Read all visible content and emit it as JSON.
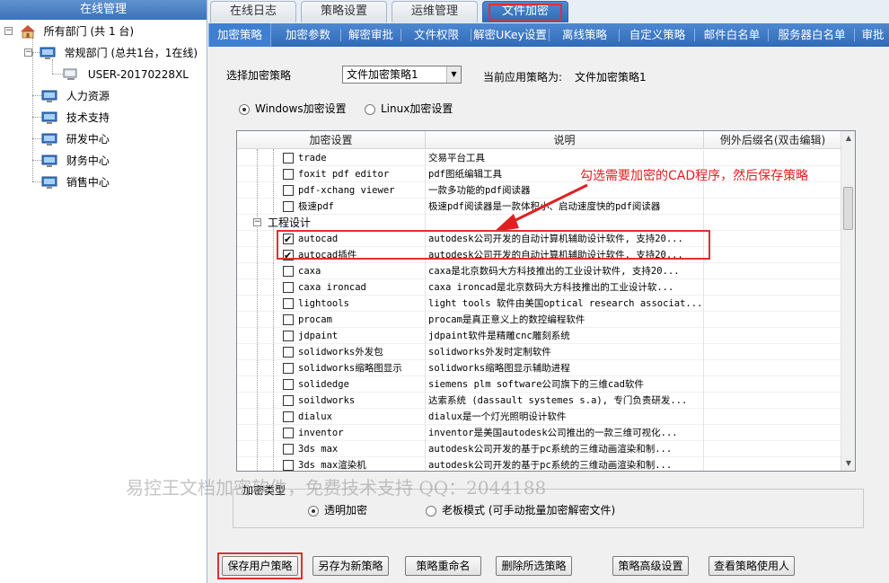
{
  "left_panel": {
    "title": "在线管理",
    "root": "所有部门 (共 1 台)",
    "group": "常规部门 (总共1台，1在线)",
    "computer": "USER-20170228XL",
    "departments": [
      "人力资源",
      "技术支持",
      "研发中心",
      "财务中心",
      "销售中心"
    ]
  },
  "top_tabs": [
    "在线日志",
    "策略设置",
    "运维管理",
    "文件加密"
  ],
  "top_tab_active": "文件加密",
  "sub_tabs": [
    "加密策略",
    "加密参数",
    "解密审批",
    "文件权限",
    "解密UKey设置",
    "离线策略",
    "自定义策略",
    "邮件白名单",
    "服务器白名单",
    "审批"
  ],
  "policy": {
    "select_label": "选择加密策略",
    "selected": "文件加密策略1",
    "current_label": "当前应用策略为:",
    "current_value": "文件加密策略1"
  },
  "os_tabs": {
    "windows": "Windows加密设置",
    "linux": "Linux加密设置",
    "selected": "windows"
  },
  "grid": {
    "headers": [
      "加密设置",
      "说明",
      "例外后缀名(双击编辑)"
    ],
    "group_label": "工程设计",
    "rows_before": [
      {
        "name": "trade",
        "desc": "交易平台工具",
        "checked": false
      },
      {
        "name": "foxit pdf editor",
        "desc": "pdf图纸编辑工具",
        "checked": false
      },
      {
        "name": "pdf-xchang viewer",
        "desc": "一款多功能的pdf阅读器",
        "checked": false
      },
      {
        "name": "极速pdf",
        "desc": "极速pdf阅读器是一款体积小、启动速度快的pdf阅读器",
        "checked": false
      }
    ],
    "rows_after": [
      {
        "name": "autocad",
        "desc": "autodesk公司开发的自动计算机辅助设计软件, 支持20...",
        "checked": true
      },
      {
        "name": "autocad插件",
        "desc": "autodesk公司开发的自动计算机辅助设计软件, 支持20...",
        "checked": true
      },
      {
        "name": "caxa",
        "desc": "caxa是北京数码大方科技推出的工业设计软件, 支持20...",
        "checked": false
      },
      {
        "name": "caxa ironcad",
        "desc": "caxa ironcad是北京数码大方科技推出的工业设计软...",
        "checked": false
      },
      {
        "name": "lightools",
        "desc": "light tools 软件由美国optical research associat...",
        "checked": false
      },
      {
        "name": "procam",
        "desc": "procam是真正意义上的数控编程软件",
        "checked": false
      },
      {
        "name": "jdpaint",
        "desc": "jdpaint软件是精雕cnc雕刻系统",
        "checked": false
      },
      {
        "name": "solidworks外发包",
        "desc": "solidworks外发时定制软件",
        "checked": false
      },
      {
        "name": "solidworks缩略图显示",
        "desc": "solidworks缩略图显示辅助进程",
        "checked": false
      },
      {
        "name": "solidedge",
        "desc": "siemens plm software公司旗下的三维cad软件",
        "checked": false
      },
      {
        "name": "soildworks",
        "desc": "达索系统 (dassault systemes s.a), 专门负责研发...",
        "checked": false
      },
      {
        "name": "dialux",
        "desc": "dialux是一个灯光照明设计软件",
        "checked": false
      },
      {
        "name": "inventor",
        "desc": "inventor是美国autodesk公司推出的一款三维可视化...",
        "checked": false
      },
      {
        "name": "3ds max",
        "desc": "autodesk公司开发的基于pc系统的三维动画渲染和制...",
        "checked": false
      },
      {
        "name": "3ds max渲染机",
        "desc": "autodesk公司开发的基于pc系统的三维动画渲染和制...",
        "checked": false
      }
    ]
  },
  "annotation": "勾选需要加密的CAD程序，然后保存策略",
  "encrypt_type": {
    "title": "加密类型",
    "transparent": "透明加密",
    "boss": "老板模式 (可手动批量加密解密文件)",
    "selected": "transparent"
  },
  "buttons": [
    "保存用户策略",
    "另存为新策略",
    "策略重命名",
    "删除所选策略",
    "策略高级设置",
    "查看策略使用人"
  ],
  "watermark": "易控王文档加密软件，免费技术支持 QQ：2044188"
}
